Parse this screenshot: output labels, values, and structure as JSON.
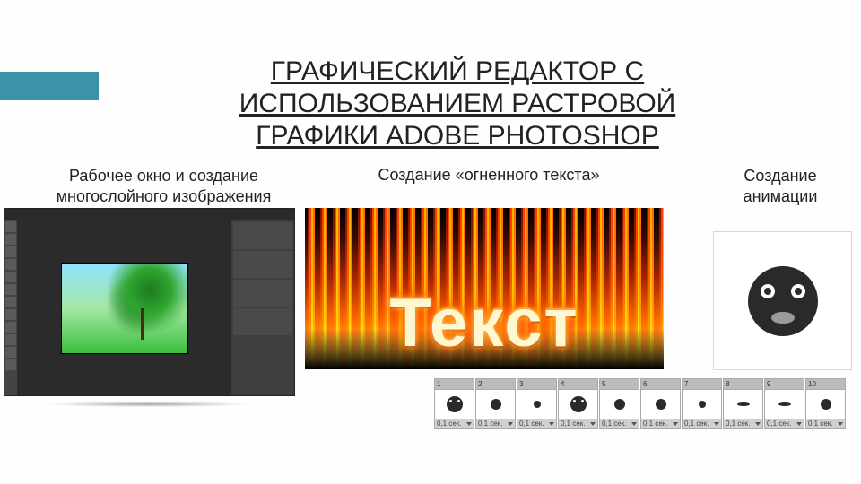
{
  "accent_color": "#3a93a8",
  "title": "ГРАФИЧЕСКИЙ РЕДАКТОР С ИСПОЛЬЗОВАНИЕМ РАСТРОВОЙ ГРАФИКИ ADOBE PHOTOSHOP",
  "captions": {
    "col1": "Рабочее окно и создание многослойного изображения",
    "col2": "Создание «огненного текста»",
    "col3": "Создание анимации"
  },
  "fire_word": "Текст",
  "frames": [
    {
      "num": "1",
      "duration": "0,1 сек.",
      "variant": "face2"
    },
    {
      "num": "2",
      "duration": "0,1 сек.",
      "variant": "normal"
    },
    {
      "num": "3",
      "duration": "0,1 сек.",
      "variant": "sm"
    },
    {
      "num": "4",
      "duration": "0,1 сек.",
      "variant": "face2"
    },
    {
      "num": "5",
      "duration": "0,1 сек.",
      "variant": "normal"
    },
    {
      "num": "6",
      "duration": "0,1 сек.",
      "variant": "normal"
    },
    {
      "num": "7",
      "duration": "0,1 сек.",
      "variant": "sm"
    },
    {
      "num": "8",
      "duration": "0,1 сек.",
      "variant": "flat"
    },
    {
      "num": "9",
      "duration": "0,1 сек.",
      "variant": "flat"
    },
    {
      "num": "10",
      "duration": "0,1 сек.",
      "variant": "normal"
    }
  ]
}
